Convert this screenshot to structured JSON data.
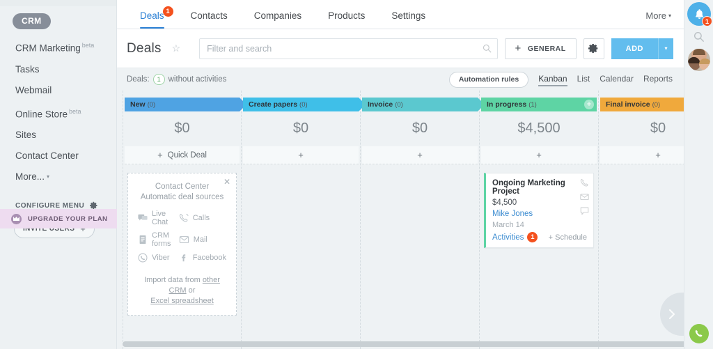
{
  "sidebar": {
    "brand_badge": "CRM",
    "items": [
      {
        "label": "CRM Marketing",
        "beta": "beta"
      },
      {
        "label": "Tasks",
        "beta": ""
      },
      {
        "label": "Webmail",
        "beta": ""
      },
      {
        "label": "Online Store",
        "beta": "beta"
      },
      {
        "label": "Sites",
        "beta": ""
      },
      {
        "label": "Contact Center",
        "beta": ""
      },
      {
        "label": "More...",
        "beta": "",
        "caret": "▾"
      }
    ],
    "configure_menu": "CONFIGURE MENU",
    "invite_users": "INVITE USERS",
    "invite_plus": "+",
    "upgrade": "UPGRADE YOUR PLAN"
  },
  "topnav": {
    "tabs": [
      {
        "label": "Deals",
        "badge": "1",
        "active": true
      },
      {
        "label": "Contacts",
        "badge": "",
        "active": false
      },
      {
        "label": "Companies",
        "badge": "",
        "active": false
      },
      {
        "label": "Products",
        "badge": "",
        "active": false
      },
      {
        "label": "Settings",
        "badge": "",
        "active": false
      }
    ],
    "more": "More",
    "more_caret": "▾"
  },
  "toolbar": {
    "title": "Deals",
    "star": "☆",
    "search_placeholder": "Filter and search",
    "search_value": "",
    "general_label": "GENERAL",
    "general_plus": "+",
    "add_label": "ADD",
    "add_caret": "▾"
  },
  "subbar": {
    "deals_label": "Deals:",
    "deals_count": "1",
    "deals_suffix": "without activities",
    "automation_rules": "Automation rules",
    "views": [
      {
        "label": "Kanban",
        "active": true
      },
      {
        "label": "List",
        "active": false
      },
      {
        "label": "Calendar",
        "active": false
      },
      {
        "label": "Reports",
        "active": false
      }
    ]
  },
  "kanban": {
    "columns": [
      {
        "name": "New",
        "count": "(0)",
        "sum": "$0",
        "add_label": "Quick Deal",
        "add_plus": "+",
        "color": "#4fa3e3",
        "has_add_circle": false
      },
      {
        "name": "Create papers",
        "count": "(0)",
        "sum": "$0",
        "add_label": "",
        "add_plus": "+",
        "color": "#3fbfe8",
        "has_add_circle": false
      },
      {
        "name": "Invoice",
        "count": "(0)",
        "sum": "$0",
        "add_label": "",
        "add_plus": "+",
        "color": "#5bc8cf",
        "has_add_circle": false
      },
      {
        "name": "In progress",
        "count": "(1)",
        "sum": "$4,500",
        "add_label": "",
        "add_plus": "+",
        "color": "#5ed4a4",
        "has_add_circle": true
      },
      {
        "name": "Final invoice",
        "count": "(0)",
        "sum": "$0",
        "add_label": "",
        "add_plus": "+",
        "color": "#f0a93c",
        "has_add_circle": false
      }
    ],
    "promo": {
      "close": "✕",
      "title_line1": "Contact Center",
      "title_line2": "Automatic deal sources",
      "sources": [
        {
          "label": "Live Chat",
          "icon": "live-chat-icon"
        },
        {
          "label": "Calls",
          "icon": "phone-icon"
        },
        {
          "label": "CRM forms",
          "icon": "form-icon"
        },
        {
          "label": "Mail",
          "icon": "mail-icon"
        },
        {
          "label": "Viber",
          "icon": "viber-icon"
        },
        {
          "label": "Facebook",
          "icon": "facebook-icon"
        }
      ],
      "import_prefix": "Import data from",
      "import_link1": "other CRM",
      "import_mid": "or",
      "import_link2": "Excel spreadsheet"
    },
    "deal": {
      "title": "Ongoing Marketing Project",
      "amount": "$4,500",
      "person": "Mike Jones",
      "date": "March 14",
      "activities_label": "Activities",
      "activities_count": "1",
      "schedule": "+ Schedule"
    }
  },
  "rightrail": {
    "notifications_count": "1"
  }
}
